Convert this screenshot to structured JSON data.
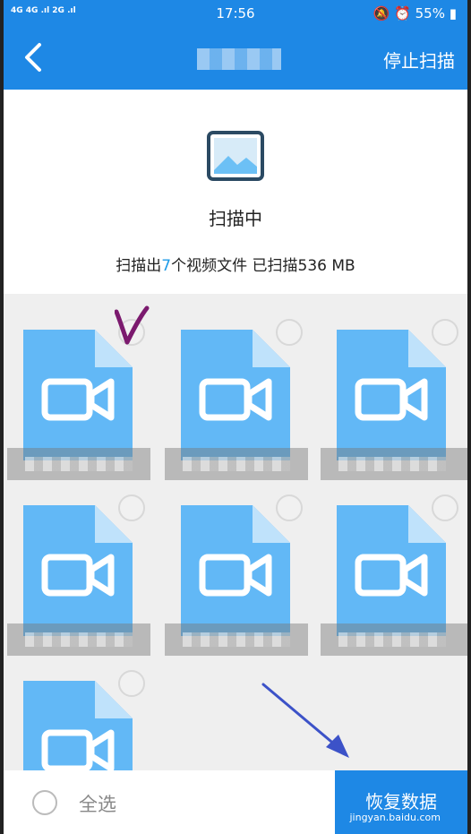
{
  "status_bar": {
    "signal": "4G 4G .ıl 2G .ıl",
    "time": "17:56",
    "right": "🔕 ⏰ 55% ▮"
  },
  "app_bar": {
    "stop_scan_label": "停止扫描"
  },
  "scan": {
    "status": "扫描中",
    "summary_prefix": "扫描出",
    "count": "7",
    "summary_suffix": "个视频文件 已扫描536 MB"
  },
  "files": [
    {
      "selected": true
    },
    {
      "selected": false
    },
    {
      "selected": false
    },
    {
      "selected": false
    },
    {
      "selected": false
    },
    {
      "selected": false
    },
    {
      "selected": false
    }
  ],
  "bottom_bar": {
    "select_all_label": "全选",
    "recover_label": "恢复数据"
  },
  "watermark": "jingyan.baidu.com",
  "colors": {
    "accent": "#1e88e5",
    "file_icon": "#62b8f6",
    "count": "#1e9be8",
    "check": "#7b1a6e"
  }
}
